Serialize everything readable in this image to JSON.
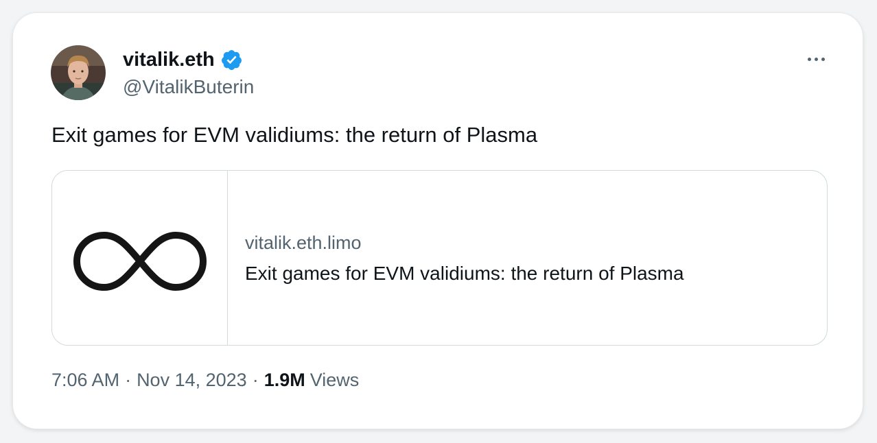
{
  "tweet": {
    "author": {
      "display_name": "vitalik.eth",
      "handle": "@VitalikButerin",
      "verified": true,
      "avatar_icon": "avatar-photo"
    },
    "menu_icon": "more-horizontal-icon",
    "text": "Exit games for EVM validiums: the return of Plasma",
    "link_card": {
      "thumbnail_icon": "infinity-icon",
      "domain": "vitalik.eth.limo",
      "title": "Exit games for EVM validiums: the return of Plasma"
    },
    "meta": {
      "time": "7:06 AM",
      "separator": "·",
      "date": "Nov 14, 2023",
      "views_count": "1.9M",
      "views_label": "Views"
    }
  },
  "colors": {
    "text_primary": "#0f1419",
    "text_secondary": "#536471",
    "verified_blue": "#1d9bf0",
    "border": "#cfd9de"
  }
}
